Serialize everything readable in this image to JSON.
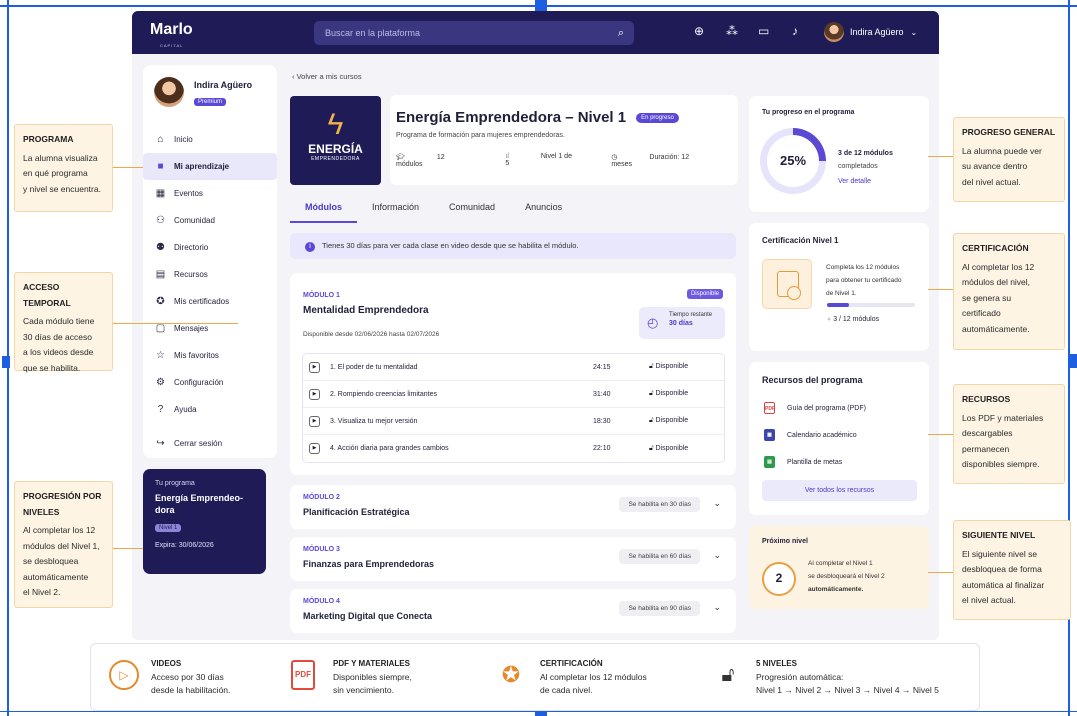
{
  "topbar": {
    "logo": "Marlo",
    "logo_sub": "CAPITAL",
    "search_placeholder": "Buscar en la plataforma",
    "user_name": "Indira Agüero"
  },
  "sidebar": {
    "user_name": "Indira Agüero",
    "user_badge": "Premium",
    "items": [
      {
        "label": "Inicio",
        "icon": "home-icon"
      },
      {
        "label": "Mi aprendizaje",
        "icon": "book-icon"
      },
      {
        "label": "Eventos",
        "icon": "calendar-icon"
      },
      {
        "label": "Comunidad",
        "icon": "community-icon"
      },
      {
        "label": "Directorio",
        "icon": "users-icon"
      },
      {
        "label": "Recursos",
        "icon": "resources-icon"
      },
      {
        "label": "Mis certificados",
        "icon": "certificate-icon"
      },
      {
        "label": "Mensajes",
        "icon": "message-icon"
      },
      {
        "label": "Mis favoritos",
        "icon": "star-icon"
      },
      {
        "label": "Configuración",
        "icon": "gear-icon"
      },
      {
        "label": "Ayuda",
        "icon": "help-icon"
      }
    ],
    "logout": "Cerrar sesión"
  },
  "program_card": {
    "label": "Tu programa",
    "name": "Energía Emprendeo-dora",
    "level": "Nivel 1",
    "expires": "Expira: 30/06/2026"
  },
  "course": {
    "back": "‹  Volver a mis cursos",
    "img_title": "ENERGÍA",
    "img_sub": "EMPRENDEDORA",
    "title": "Energía Emprendedora – Nivel 1",
    "status": "En progreso",
    "subtitle": "Programa de formación para mujeres emprendedoras.",
    "meta_modules": "12 módulos",
    "meta_level": "Nivel 1 de 5",
    "meta_duration": "Duración: 12 meses"
  },
  "tabs": [
    "Módulos",
    "Información",
    "Comunidad",
    "Anuncios"
  ],
  "notice": "Tienes 30 días para ver cada clase en video desde que se habilita el módulo.",
  "module1": {
    "label": "MÓDULO 1",
    "title": "Mentalidad Emprendedora",
    "badge": "Disponible",
    "dates": "Disponible desde 02/06/2026 hasta 02/07/2026",
    "timer_label": "Tiempo restante",
    "timer_value": "30 días",
    "lessons": [
      {
        "title": "1. El poder de tu mentalidad",
        "duration": "24:15",
        "status": "Disponible"
      },
      {
        "title": "2. Rompiendo creencias limitantes",
        "duration": "31:40",
        "status": "Disponible"
      },
      {
        "title": "3. Visualiza tu mejor versión",
        "duration": "18:30",
        "status": "Disponible"
      },
      {
        "title": "4. Acción diaria para grandes cambios",
        "duration": "22:10",
        "status": "Disponible"
      }
    ]
  },
  "modules": [
    {
      "label": "MÓDULO 2",
      "title": "Planificación Estratégica",
      "hint": "Se habilita en 30 días"
    },
    {
      "label": "MÓDULO 3",
      "title": "Finanzas para Emprendedoras",
      "hint": "Se habilita en 60 días"
    },
    {
      "label": "MÓDULO 4",
      "title": "Marketing Digital que Conecta",
      "hint": "Se habilita en 90 días"
    }
  ],
  "progress": {
    "title": "Tu progreso en el programa",
    "percent": "25%",
    "fraction": 0.25,
    "line1": "3 de 12 módulos",
    "line2": "completados",
    "link": "Ver detalle"
  },
  "certification": {
    "title": "Certificación Nivel 1",
    "desc1": "Completa los 12 módulos",
    "desc2": "para obtener tu certificado",
    "desc3": "de Nivel 1.",
    "count": "3 / 12 módulos",
    "fraction": 0.25
  },
  "resources": {
    "title": "Recursos del programa",
    "items": [
      {
        "label": "Guía del programa (PDF)",
        "icon": "pdf-icon"
      },
      {
        "label": "Calendario académico",
        "icon": "calendar-icon"
      },
      {
        "label": "Plantilla de metas",
        "icon": "sheet-icon"
      }
    ],
    "button": "Ver todos los recursos"
  },
  "next_level": {
    "title": "Próximo nivel",
    "number": "2",
    "line1": "Al completar el Nivel 1",
    "line2": "se desbloqueará el Nivel 2",
    "line3": "automáticamente."
  },
  "callouts": {
    "programa": {
      "title": "PROGRAMA",
      "lines": [
        "La alumna visualiza",
        "en qué programa",
        "y nivel se encuentra."
      ]
    },
    "acceso": {
      "title": "ACCESO TEMPORAL",
      "lines": [
        "Cada módulo tiene",
        "30 días de acceso",
        "a los videos desde",
        "que se habilita."
      ]
    },
    "progresion": {
      "title": "PROGRESIÓN POR NIVELES",
      "lines": [
        "Al completar los 12",
        "módulos del Nivel 1,",
        "se desbloquea",
        "automáticamente",
        "el Nivel 2."
      ]
    },
    "progreso": {
      "title": "PROGRESO GENERAL",
      "lines": [
        "La alumna puede ver",
        "su avance dentro",
        "del nivel actual."
      ]
    },
    "certificacion": {
      "title": "CERTIFICACIÓN",
      "lines": [
        "Al completar los 12",
        "módulos del nivel,",
        "se genera su",
        "certificado",
        "automáticamente."
      ]
    },
    "recursos": {
      "title": "RECURSOS",
      "lines": [
        "Los PDF y materiales",
        "descargables",
        "permanecen",
        "disponibles siempre."
      ]
    },
    "siguiente": {
      "title": "SIGUIENTE NIVEL",
      "lines": [
        "El siguiente nivel se",
        "desbloquea de forma",
        "automática al finalizar",
        "el nivel actual."
      ]
    }
  },
  "features": [
    {
      "title": "VIDEOS",
      "l1": "Acceso por 30 días",
      "l2": "desde la habilitación.",
      "icon": "play-icon"
    },
    {
      "title": "PDF Y MATERIALES",
      "l1": "Disponibles siempre,",
      "l2": "sin vencimiento.",
      "icon": "pdf-icon"
    },
    {
      "title": "CERTIFICACIÓN",
      "l1": "Al completar los 12 módulos",
      "l2": "de cada nivel.",
      "icon": "award-icon"
    },
    {
      "title": "5 NIVELES",
      "l1": "Progresión automática:",
      "l2": "Nivel 1 → Nivel 2 → Nivel 3 → Nivel 4 → Nivel 5",
      "icon": "lock-icon"
    }
  ],
  "colors": {
    "primary": "#5b49d6",
    "navy": "#1e1b57",
    "accent": "#f0a94a",
    "callout_bg": "#fdf4e4"
  }
}
